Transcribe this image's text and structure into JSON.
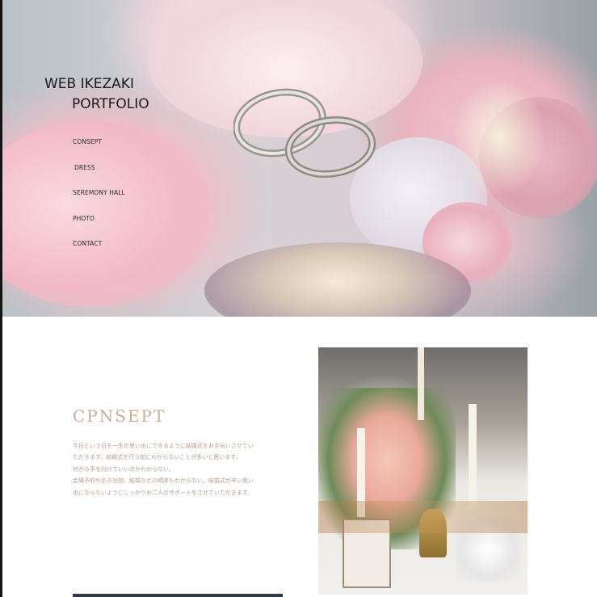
{
  "site": {
    "logo_line1": "WEB IKEZAKI",
    "logo_line2": "PORTFOLIO"
  },
  "nav": {
    "items": [
      {
        "label": "CONSEPT"
      },
      {
        "label": "DRESS"
      },
      {
        "label": "SEREMONY HALL"
      },
      {
        "label": "PHOTO"
      },
      {
        "label": "CONTACT"
      }
    ]
  },
  "concept": {
    "title": "CPNSEPT",
    "lines": [
      "今日という日を一生の思い出にできるように結婚式をお手伝いさせてい",
      "ただきます。結婚式を行う前にわからないことが多いと思います。",
      "何から手を付けていいのかわからない。",
      "会場予約や引き出物、結婚などの順序もわからない。結婚式が辛い思い",
      "出にならないようにしっかりお二人のサポートをさせていただきます。"
    ]
  },
  "colors": {
    "accent": "#c9ab98",
    "body_text": "#b69c8e",
    "nav_text": "#2b2b2b"
  }
}
